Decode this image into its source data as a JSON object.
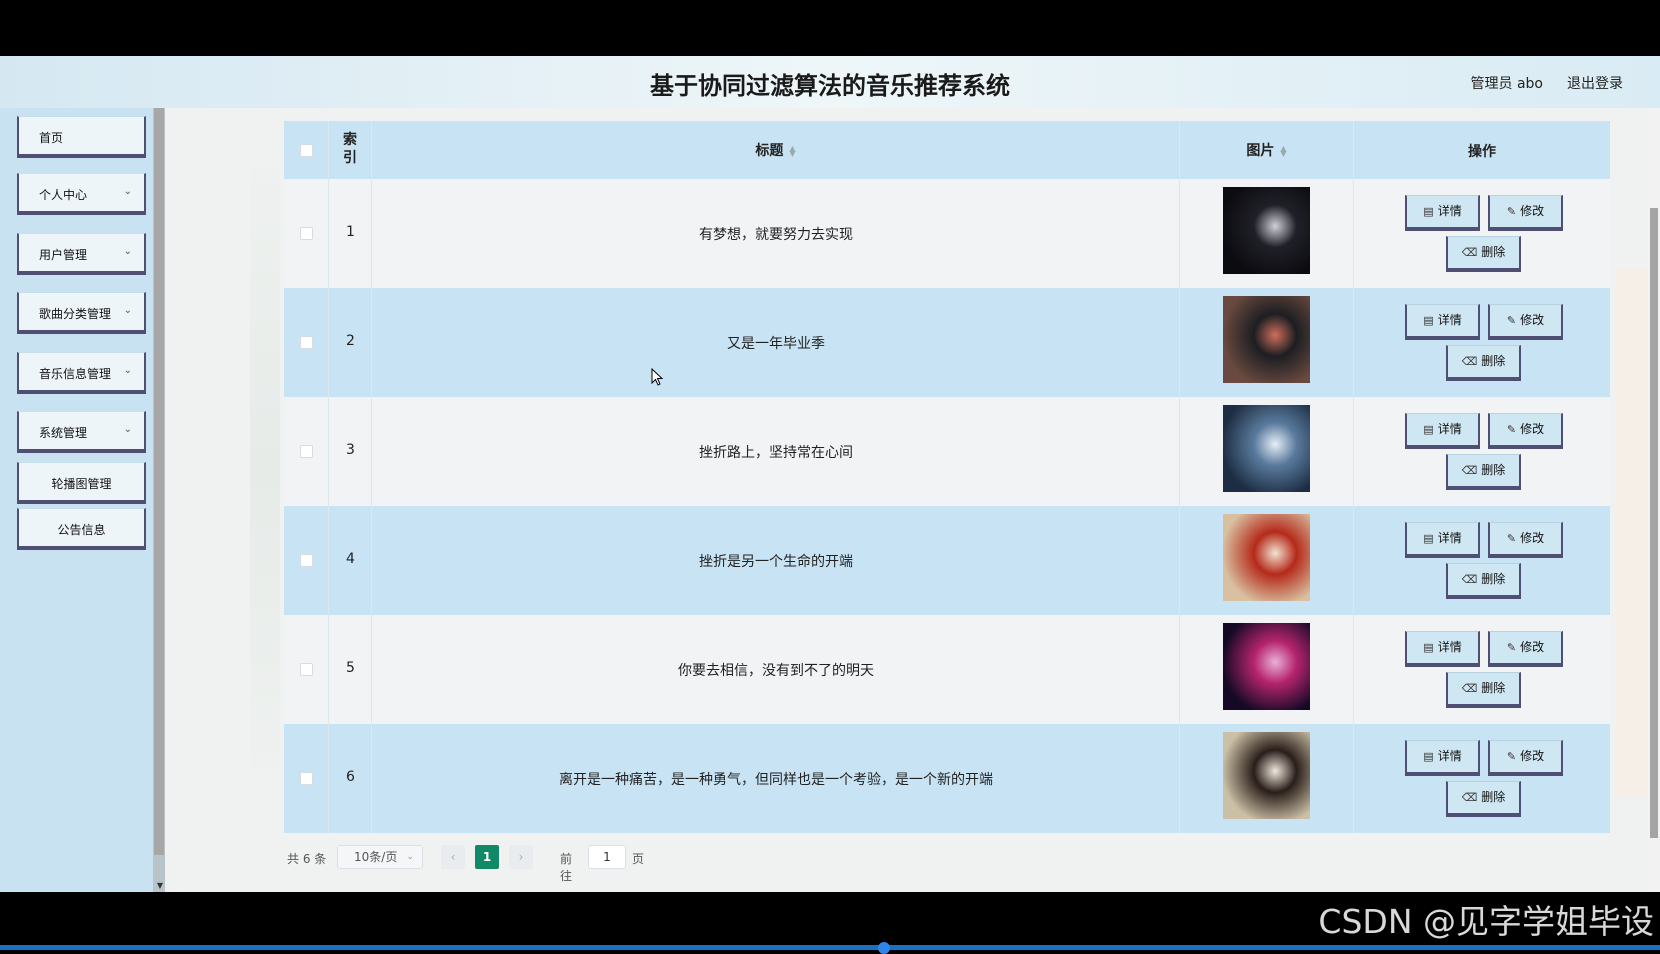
{
  "header": {
    "title": "基于协同过滤算法的音乐推荐系统",
    "user": "管理员 abo",
    "logout": "退出登录"
  },
  "sidebar": {
    "items": [
      {
        "label": "首页",
        "has_chevron": false
      },
      {
        "label": "个人中心",
        "has_chevron": true
      },
      {
        "label": "用户管理",
        "has_chevron": true
      },
      {
        "label": "歌曲分类管理",
        "has_chevron": true
      },
      {
        "label": "音乐信息管理",
        "has_chevron": true
      },
      {
        "label": "系统管理",
        "has_chevron": true
      },
      {
        "label": "轮播图管理",
        "has_chevron": false
      },
      {
        "label": "公告信息",
        "has_chevron": false
      }
    ],
    "chevron_icon": "chevron-down-icon"
  },
  "table": {
    "headers": {
      "index": "索引",
      "title": "标题",
      "image": "图片",
      "ops": "操作"
    },
    "rows": [
      {
        "index": "1",
        "title": "有梦想，就要努力去实现",
        "thumb_colors": [
          "#0b0b10",
          "#202028",
          "#d0d0d8"
        ]
      },
      {
        "index": "2",
        "title": "又是一年毕业季",
        "thumb_colors": [
          "#6a4a40",
          "#1d1e22",
          "#cf6e5a"
        ]
      },
      {
        "index": "3",
        "title": "挫折路上，坚持常在心间",
        "thumb_colors": [
          "#1d2e44",
          "#5a7b9d",
          "#e6eef6"
        ]
      },
      {
        "index": "4",
        "title": "挫折是另一个生命的开端",
        "thumb_colors": [
          "#d8c0a0",
          "#b52a1a",
          "#f1e2d0"
        ]
      },
      {
        "index": "5",
        "title": "你要去相信，没有到不了的明天",
        "thumb_colors": [
          "#150a25",
          "#b5246e",
          "#eab0d8"
        ]
      },
      {
        "index": "6",
        "title": "离开是一种痛苦，是一种勇气，但同样也是一个考验，是一个新的开端",
        "thumb_colors": [
          "#cbbfa6",
          "#2a1e1a",
          "#f0e8dc"
        ]
      }
    ],
    "buttons": {
      "detail": "详情",
      "edit": "修改",
      "delete": "删除"
    },
    "icons": {
      "detail": "document-icon",
      "edit": "pencil-icon",
      "delete": "trash-icon",
      "sort": "sort-icon"
    }
  },
  "pager": {
    "total": "共 6 条",
    "page_size": "10条/页",
    "current_page": "1",
    "goto_label": "前往",
    "goto_value": "1",
    "page_suffix": "页"
  },
  "watermark": "CSDN @见字学姐毕设",
  "colors": {
    "header_bg": "#d5e8f2",
    "sidebar_bg": "#c9e2f2",
    "row_alt": "#c8e3f3",
    "button_border": "#4e4f72",
    "pager_active": "#118866"
  }
}
